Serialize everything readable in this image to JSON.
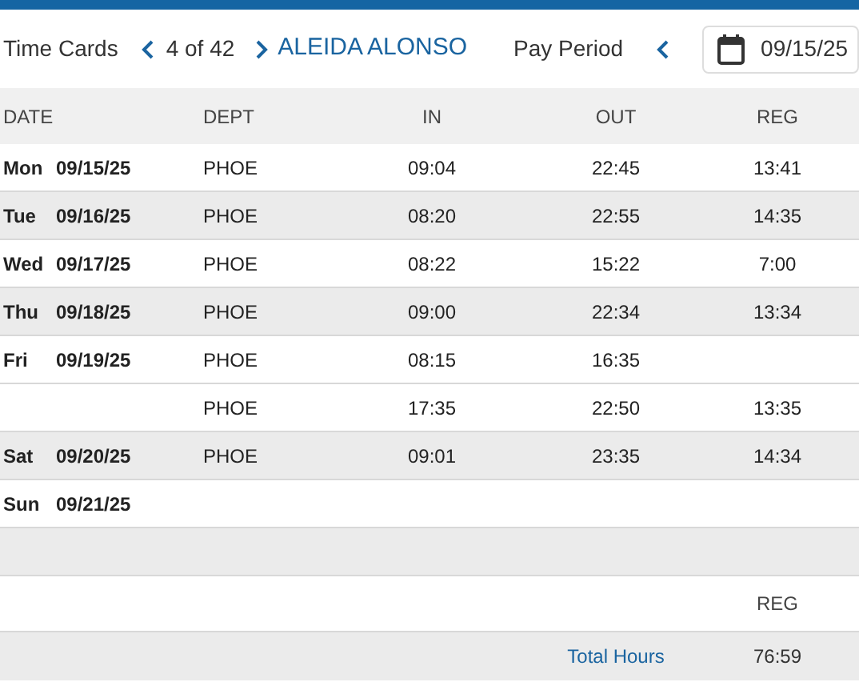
{
  "header": {
    "title": "Time Cards",
    "position": "4 of 42",
    "employee": "ALEIDA ALONSO",
    "period_label": "Pay Period",
    "period_start": "09/15/25"
  },
  "table": {
    "columns": [
      "DATE",
      "DEPT",
      "IN",
      "OUT",
      "REG"
    ],
    "rows": [
      {
        "day": "Mon",
        "date": "09/15/25",
        "dept": "PHOE",
        "in": "09:04",
        "out": "22:45",
        "reg": "13:41",
        "shaded": false
      },
      {
        "day": "Tue",
        "date": "09/16/25",
        "dept": "PHOE",
        "in": "08:20",
        "out": "22:55",
        "reg": "14:35",
        "shaded": true
      },
      {
        "day": "Wed",
        "date": "09/17/25",
        "dept": "PHOE",
        "in": "08:22",
        "out": "15:22",
        "reg": "7:00",
        "shaded": false
      },
      {
        "day": "Thu",
        "date": "09/18/25",
        "dept": "PHOE",
        "in": "09:00",
        "out": "22:34",
        "reg": "13:34",
        "shaded": true
      },
      {
        "day": "Fri",
        "date": "09/19/25",
        "dept": "PHOE",
        "in": "08:15",
        "out": "16:35",
        "shaded": false
      },
      {
        "dept": "PHOE",
        "in": "17:35",
        "out": "22:50",
        "reg": "13:35",
        "shaded": false
      },
      {
        "day": "Sat",
        "date": "09/20/25",
        "dept": "PHOE",
        "in": "09:01",
        "out": "23:35",
        "reg": "14:34",
        "shaded": true
      },
      {
        "day": "Sun",
        "date": "09/21/25",
        "shaded": false
      }
    ]
  },
  "totals": {
    "column": "REG",
    "label": "Total Hours",
    "value": "76:59"
  }
}
